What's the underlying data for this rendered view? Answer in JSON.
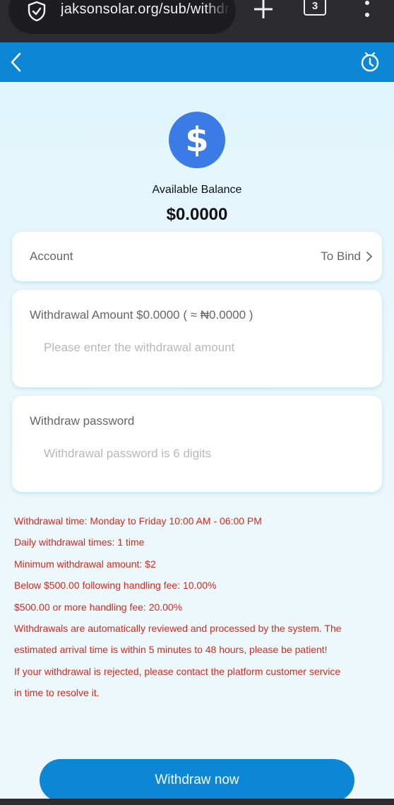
{
  "browser": {
    "url": "jaksonsolar.org/sub/withdraw",
    "tab_count": "3"
  },
  "balance": {
    "label": "Available Balance",
    "value": "$0.0000"
  },
  "account": {
    "label": "Account",
    "action": "To Bind"
  },
  "amount": {
    "label": "Withdrawal Amount $0.0000 ( ≈ ₦0.0000 )",
    "placeholder": "Please enter the withdrawal amount"
  },
  "password": {
    "label": "Withdraw password",
    "placeholder": "Withdrawal password is 6 digits"
  },
  "notes": [
    "Withdrawal time: Monday to Friday 10:00 AM - 06:00 PM",
    "Daily withdrawal times: 1 time",
    "Minimum withdrawal amount: $2",
    "Below $500.00 following handling fee: 10.00%",
    "$500.00 or more handling fee: 20.00%",
    "Withdrawals are automatically reviewed and processed by the system. The",
    "estimated arrival time is within 5 minutes to 48 hours, please be patient!",
    "If your withdrawal is rejected, please contact the platform customer service",
    "in time to resolve it."
  ],
  "submit_label": "Withdraw now",
  "icons": {
    "security": "shield-check-icon",
    "new_tab": "plus-icon",
    "tabs": "tab-count-icon",
    "menu": "more-vertical-icon",
    "back": "chevron-left-icon",
    "history": "clock-history-icon",
    "currency": "dollar-coin-icon",
    "forward": "chevron-right-icon"
  },
  "colors": {
    "primary": "#0c87d6",
    "coin": "#3b7be6",
    "notice": "#d42a1f",
    "chrome": "#2b2b30"
  }
}
